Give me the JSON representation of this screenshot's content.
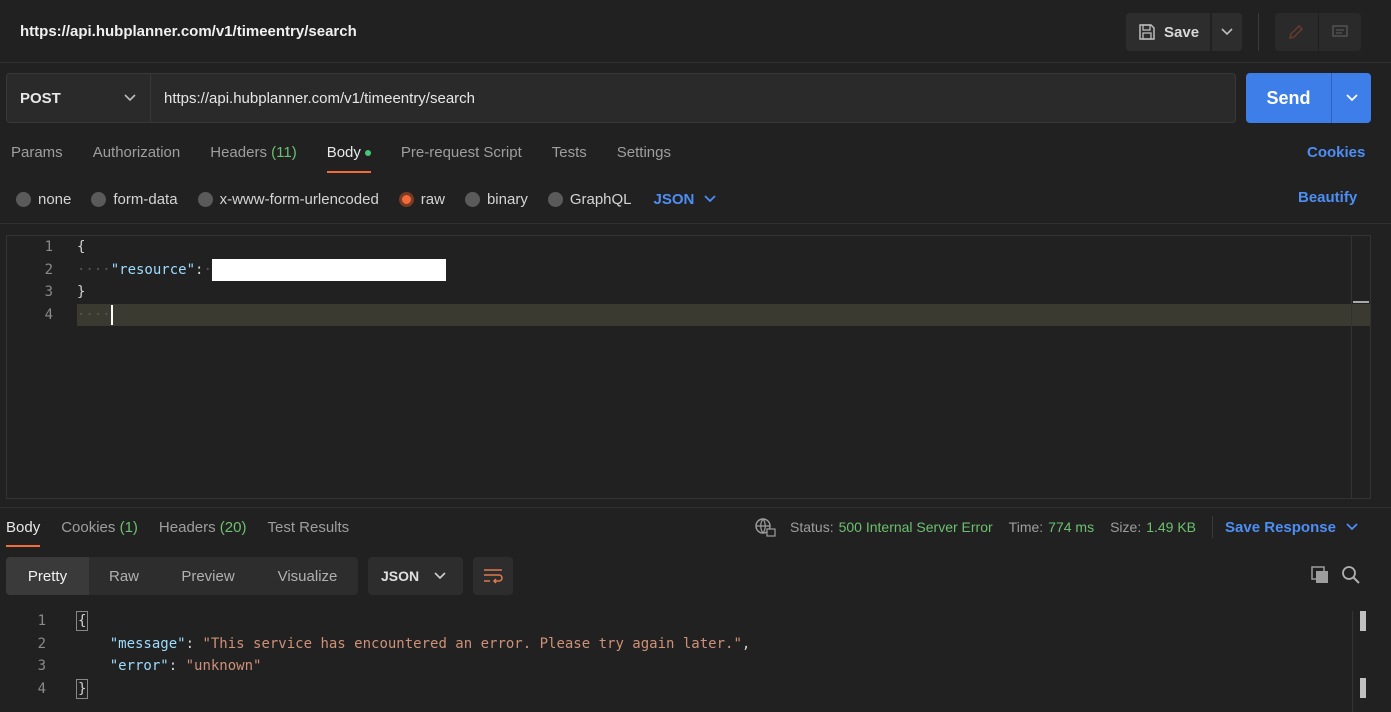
{
  "titlebar": {
    "title": "https://api.hubplanner.com/v1/timeentry/search",
    "save_label": "Save",
    "icons": [
      "save-icon",
      "chevron-down-icon",
      "pencil-icon",
      "comment-icon"
    ]
  },
  "request": {
    "method": "POST",
    "url": "https://api.hubplanner.com/v1/timeentry/search",
    "send_label": "Send"
  },
  "req_tabs": {
    "params": "Params",
    "authorization": "Authorization",
    "headers": "Headers",
    "headers_count": "(11)",
    "body": "Body",
    "prerequest": "Pre-request Script",
    "tests": "Tests",
    "settings": "Settings",
    "cookies": "Cookies"
  },
  "body_types": {
    "none": "none",
    "form_data": "form-data",
    "urlencoded": "x-www-form-urlencoded",
    "raw": "raw",
    "binary": "binary",
    "graphql": "GraphQL",
    "format": "JSON",
    "beautify": "Beautify"
  },
  "editor": {
    "lines": [
      {
        "n": "1",
        "open": "{"
      },
      {
        "n": "2",
        "key": "\"resource\"",
        "colon": ":"
      },
      {
        "n": "3",
        "close": "}"
      },
      {
        "n": "4"
      }
    ]
  },
  "response": {
    "tabs": {
      "body": "Body",
      "cookies": "Cookies",
      "cookies_count": "(1)",
      "headers": "Headers",
      "headers_count": "(20)",
      "test_results": "Test Results"
    },
    "status_label": "Status:",
    "status_value": "500 Internal Server Error",
    "time_label": "Time:",
    "time_value": "774 ms",
    "size_label": "Size:",
    "size_value": "1.49 KB",
    "save_response": "Save Response",
    "views": {
      "pretty": "Pretty",
      "raw": "Raw",
      "preview": "Preview",
      "visualize": "Visualize"
    },
    "format": "JSON",
    "lines": [
      {
        "n": "1",
        "text": "{"
      },
      {
        "n": "2",
        "key": "\"message\"",
        "value": "\"This service has encountered an error. Please try again later.\""
      },
      {
        "n": "3",
        "key": "\"error\"",
        "value": "\"unknown\""
      },
      {
        "n": "4",
        "text": "}"
      }
    ]
  },
  "colors": {
    "accent_orange": "#f26b3a",
    "link_blue": "#4d8ef5",
    "send_blue": "#3d7ee8",
    "status_green": "#6cc070"
  }
}
